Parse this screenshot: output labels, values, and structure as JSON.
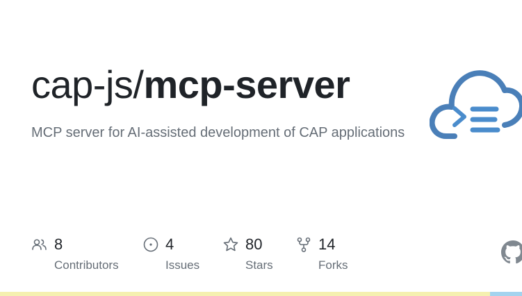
{
  "repo": {
    "owner": "cap-js/",
    "name": "mcp-server",
    "description": "MCP server for AI-assisted development of CAP applications"
  },
  "stats": {
    "contributors": {
      "count": "8",
      "label": "Contributors",
      "icon": "people-icon"
    },
    "issues": {
      "count": "4",
      "label": "Issues",
      "icon": "issue-opened-icon"
    },
    "stars": {
      "count": "80",
      "label": "Stars",
      "icon": "star-icon"
    },
    "forks": {
      "count": "14",
      "label": "Forks",
      "icon": "repo-forked-icon"
    }
  },
  "logo": {
    "icon": "cloud-terminal-icon",
    "color": "#4a7fb8"
  },
  "branding": {
    "icon": "github-mark-icon"
  },
  "colors": {
    "text_primary": "#1f2328",
    "text_secondary": "#656d76",
    "language_bar_primary": "#f5f0b0",
    "language_bar_secondary": "#a4d3ee"
  }
}
